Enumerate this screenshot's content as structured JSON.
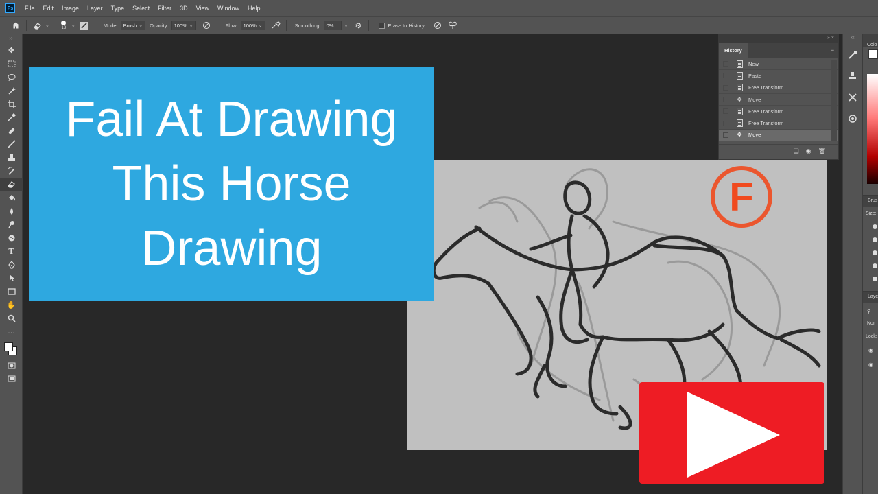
{
  "app": {
    "logo_text": "Ps"
  },
  "menu": [
    "File",
    "Edit",
    "Image",
    "Layer",
    "Type",
    "Select",
    "Filter",
    "3D",
    "View",
    "Window",
    "Help"
  ],
  "options_bar": {
    "brush_size": "13",
    "mode_label": "Mode:",
    "mode_value": "Brush",
    "opacity_label": "Opacity:",
    "opacity_value": "100%",
    "flow_label": "Flow:",
    "flow_value": "100%",
    "smoothing_label": "Smoothing:",
    "smoothing_value": "0%",
    "erase_to_history_label": "Erase to History"
  },
  "tools": [
    "move-icon",
    "marquee-icon",
    "lasso-icon",
    "magic-wand-icon",
    "crop-icon",
    "eyedropper-icon",
    "healing-brush-icon",
    "brush-icon",
    "clone-stamp-icon",
    "history-brush-icon",
    "eraser-icon",
    "paint-bucket-icon",
    "blur-icon",
    "dodge-icon",
    "sponge-icon",
    "type-icon",
    "pen-icon",
    "path-select-icon",
    "rectangle-icon",
    "hand-icon",
    "zoom-icon",
    "more-tools-icon"
  ],
  "thumbnail": {
    "title_lines": [
      "Fail At Drawing",
      "This Horse",
      "Drawing"
    ],
    "grade_letter": "F"
  },
  "history": {
    "tab_label": "History",
    "items": [
      {
        "label": "New",
        "icon": "document-icon"
      },
      {
        "label": "Paste",
        "icon": "document-icon"
      },
      {
        "label": "Free Transform",
        "icon": "document-icon"
      },
      {
        "label": "Move",
        "icon": "move-icon"
      },
      {
        "label": "Free Transform",
        "icon": "document-icon"
      },
      {
        "label": "Free Transform",
        "icon": "document-icon"
      },
      {
        "label": "Move",
        "icon": "move-icon",
        "selected": true
      }
    ]
  },
  "right_panel": {
    "color_tab": "Colo",
    "brush_tab": "Brus",
    "size_label": "Size:",
    "layers_tab": "Laye",
    "blend_mode": "Nor",
    "lock_label": "Lock:"
  },
  "colors": {
    "title_card_bg": "#2ea8e0",
    "play_button_bg": "#ee1c24",
    "grade_circle": "#f04a1e",
    "canvas_bg": "#c0c0c0"
  }
}
